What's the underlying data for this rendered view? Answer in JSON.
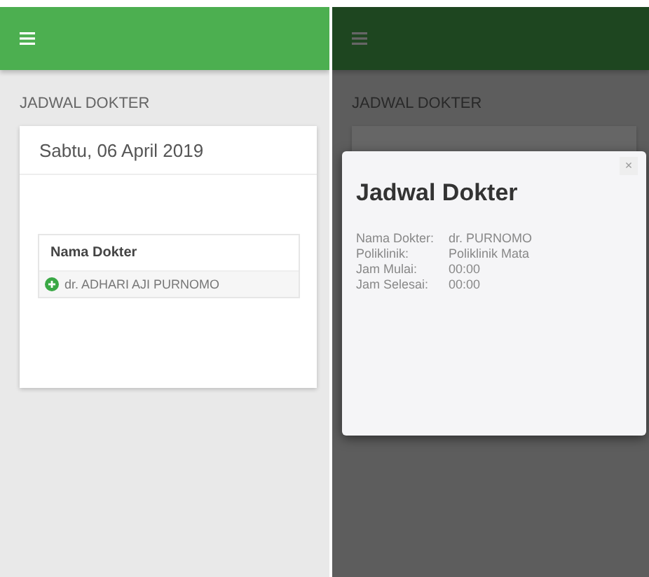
{
  "left_screen": {
    "section_title": "JADWAL DOKTER",
    "date": "Sabtu, 06 April 2019",
    "table": {
      "header": "Nama Dokter",
      "rows": [
        {
          "name": "dr. ADHARI AJI PURNOMO"
        }
      ]
    }
  },
  "right_screen": {
    "section_title": "JADWAL DOKTER",
    "dialog": {
      "title": "Jadwal Dokter",
      "close": "×",
      "fields": [
        {
          "label": "Nama Dokter:",
          "value": "dr. PURNOMO"
        },
        {
          "label": "Poliklinik:",
          "value": "Poliklinik Mata"
        },
        {
          "label": "Jam Mulai:",
          "value": "00:00"
        },
        {
          "label": "Jam Selesai:",
          "value": "00:00"
        }
      ]
    }
  }
}
